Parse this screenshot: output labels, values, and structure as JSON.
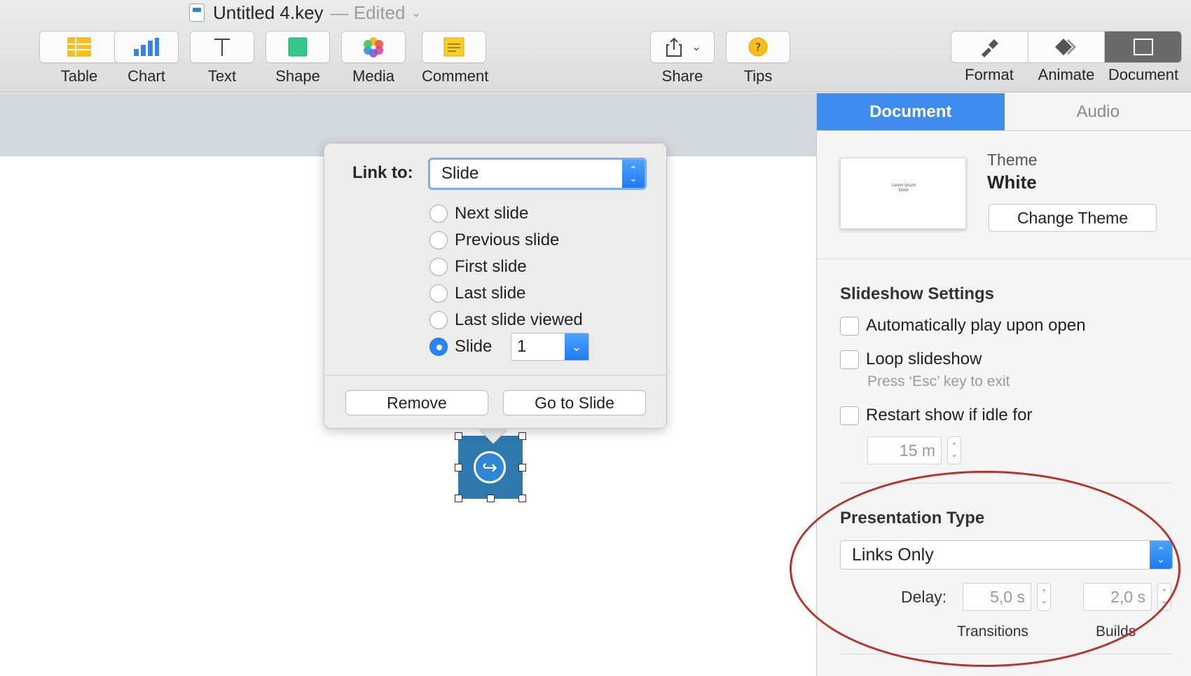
{
  "window": {
    "title": "Untitled 4.key",
    "edited": "— Edited"
  },
  "toolbar": {
    "table": "Table",
    "chart": "Chart",
    "text": "Text",
    "shape": "Shape",
    "media": "Media",
    "comment": "Comment",
    "share": "Share",
    "tips": "Tips",
    "format": "Format",
    "animate": "Animate",
    "document": "Document"
  },
  "popover": {
    "link_label": "Link to:",
    "link_value": "Slide",
    "options": [
      "Next slide",
      "Previous slide",
      "First slide",
      "Last slide",
      "Last slide viewed",
      "Slide"
    ],
    "selected_index": 5,
    "slide_number": "1",
    "remove": "Remove",
    "go_to_slide": "Go to Slide"
  },
  "inspector": {
    "tabs": [
      "Document",
      "Audio"
    ],
    "theme_label": "Theme",
    "theme_name": "White",
    "theme_thumb_text": "Lorem Ipsum Dolor",
    "change_theme": "Change Theme",
    "slideshow_title": "Slideshow Settings",
    "autoplay": "Automatically play upon open",
    "loop": "Loop slideshow",
    "loop_note": "Press ‘Esc’ key to exit",
    "restart": "Restart show if idle for",
    "idle_value": "15 m",
    "presentation_title": "Presentation Type",
    "presentation_value": "Links Only",
    "delay_label": "Delay:",
    "transitions_value": "5,0 s",
    "builds_value": "2,0 s",
    "transitions_label": "Transitions",
    "builds_label": "Builds"
  },
  "colors": {
    "accent": "#3e8cf0",
    "annotation": "#b5342c",
    "object_fill": "#2e79ad"
  }
}
